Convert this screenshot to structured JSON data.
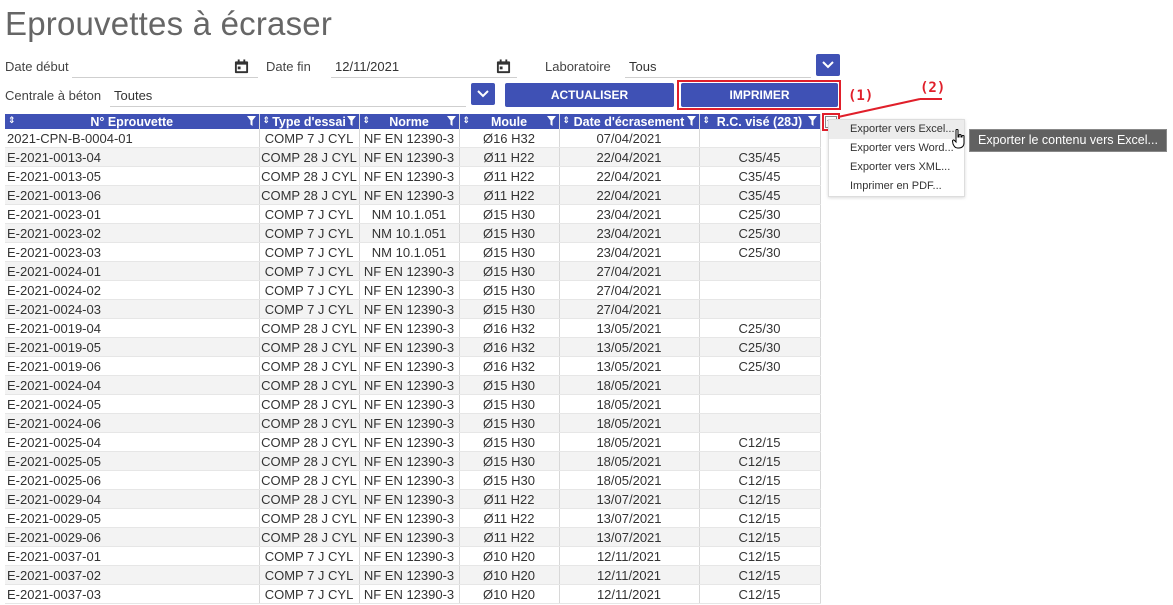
{
  "page": {
    "title": "Eprouvettes à écraser"
  },
  "filters": {
    "date_debut_label": "Date début",
    "date_debut_value": "",
    "date_fin_label": "Date fin",
    "date_fin_value": "12/11/2021",
    "laboratoire_label": "Laboratoire",
    "laboratoire_value": "Tous",
    "centrale_label": "Centrale à béton",
    "centrale_value": "Toutes"
  },
  "buttons": {
    "actualiser": "ACTUALISER",
    "imprimer": "IMPRIMER"
  },
  "annotations": {
    "marker1": "(1)",
    "marker2": "(2)",
    "color": "#e01f2a"
  },
  "colors": {
    "accent": "#3f51b5"
  },
  "table": {
    "columns": [
      "N° Eprouvette",
      "Type d'essai",
      "Norme",
      "Moule",
      "Date d'écrasement",
      "R.C. visé (28J)"
    ],
    "rows": [
      [
        "2021-CPN-B-0004-01",
        "COMP 7 J CYL",
        "NF EN 12390-3",
        "Ø16 H32",
        "07/04/2021",
        ""
      ],
      [
        "E-2021-0013-04",
        "COMP 28 J CYL",
        "NF EN 12390-3",
        "Ø11 H22",
        "22/04/2021",
        "C35/45"
      ],
      [
        "E-2021-0013-05",
        "COMP 28 J CYL",
        "NF EN 12390-3",
        "Ø11 H22",
        "22/04/2021",
        "C35/45"
      ],
      [
        "E-2021-0013-06",
        "COMP 28 J CYL",
        "NF EN 12390-3",
        "Ø11 H22",
        "22/04/2021",
        "C35/45"
      ],
      [
        "E-2021-0023-01",
        "COMP 7 J CYL",
        "NM 10.1.051",
        "Ø15 H30",
        "23/04/2021",
        "C25/30"
      ],
      [
        "E-2021-0023-02",
        "COMP 7 J CYL",
        "NM 10.1.051",
        "Ø15 H30",
        "23/04/2021",
        "C25/30"
      ],
      [
        "E-2021-0023-03",
        "COMP 7 J CYL",
        "NM 10.1.051",
        "Ø15 H30",
        "23/04/2021",
        "C25/30"
      ],
      [
        "E-2021-0024-01",
        "COMP 7 J CYL",
        "NF EN 12390-3",
        "Ø15 H30",
        "27/04/2021",
        ""
      ],
      [
        "E-2021-0024-02",
        "COMP 7 J CYL",
        "NF EN 12390-3",
        "Ø15 H30",
        "27/04/2021",
        ""
      ],
      [
        "E-2021-0024-03",
        "COMP 7 J CYL",
        "NF EN 12390-3",
        "Ø15 H30",
        "27/04/2021",
        ""
      ],
      [
        "E-2021-0019-04",
        "COMP 28 J CYL",
        "NF EN 12390-3",
        "Ø16 H32",
        "13/05/2021",
        "C25/30"
      ],
      [
        "E-2021-0019-05",
        "COMP 28 J CYL",
        "NF EN 12390-3",
        "Ø16 H32",
        "13/05/2021",
        "C25/30"
      ],
      [
        "E-2021-0019-06",
        "COMP 28 J CYL",
        "NF EN 12390-3",
        "Ø16 H32",
        "13/05/2021",
        "C25/30"
      ],
      [
        "E-2021-0024-04",
        "COMP 28 J CYL",
        "NF EN 12390-3",
        "Ø15 H30",
        "18/05/2021",
        ""
      ],
      [
        "E-2021-0024-05",
        "COMP 28 J CYL",
        "NF EN 12390-3",
        "Ø15 H30",
        "18/05/2021",
        ""
      ],
      [
        "E-2021-0024-06",
        "COMP 28 J CYL",
        "NF EN 12390-3",
        "Ø15 H30",
        "18/05/2021",
        ""
      ],
      [
        "E-2021-0025-04",
        "COMP 28 J CYL",
        "NF EN 12390-3",
        "Ø15 H30",
        "18/05/2021",
        "C12/15"
      ],
      [
        "E-2021-0025-05",
        "COMP 28 J CYL",
        "NF EN 12390-3",
        "Ø15 H30",
        "18/05/2021",
        "C12/15"
      ],
      [
        "E-2021-0025-06",
        "COMP 28 J CYL",
        "NF EN 12390-3",
        "Ø15 H30",
        "18/05/2021",
        "C12/15"
      ],
      [
        "E-2021-0029-04",
        "COMP 28 J CYL",
        "NF EN 12390-3",
        "Ø11 H22",
        "13/07/2021",
        "C12/15"
      ],
      [
        "E-2021-0029-05",
        "COMP 28 J CYL",
        "NF EN 12390-3",
        "Ø11 H22",
        "13/07/2021",
        "C12/15"
      ],
      [
        "E-2021-0029-06",
        "COMP 28 J CYL",
        "NF EN 12390-3",
        "Ø11 H22",
        "13/07/2021",
        "C12/15"
      ],
      [
        "E-2021-0037-01",
        "COMP 7 J CYL",
        "NF EN 12390-3",
        "Ø10 H20",
        "12/11/2021",
        "C12/15"
      ],
      [
        "E-2021-0037-02",
        "COMP 7 J CYL",
        "NF EN 12390-3",
        "Ø10 H20",
        "12/11/2021",
        "C12/15"
      ],
      [
        "E-2021-0037-03",
        "COMP 7 J CYL",
        "NF EN 12390-3",
        "Ø10 H20",
        "12/11/2021",
        "C12/15"
      ]
    ]
  },
  "export_menu": {
    "items": [
      "Exporter vers Excel...",
      "Exporter vers Word...",
      "Exporter vers XML...",
      "Imprimer en PDF..."
    ],
    "tooltip": "Exporter le contenu vers Excel..."
  }
}
